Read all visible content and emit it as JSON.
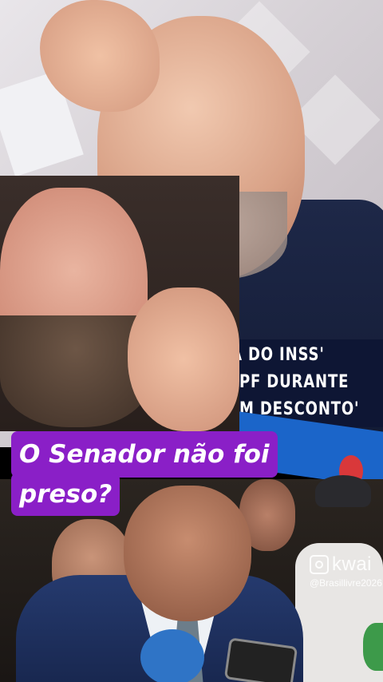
{
  "news_caption": {
    "line1": "ILHO D   ECA DO INSS'",
    "line2": "PF DURANTE",
    "line3": "M DESCONTO'"
  },
  "subtitle": {
    "line1": "O Senador não foi",
    "line2": "preso?"
  },
  "watermark": {
    "brand": "kwai",
    "handle": "@Brasillivre2026"
  },
  "colors": {
    "subtitle_bg": "#8a1fc7",
    "news_band": "#0e1634"
  },
  "icons": {
    "watermark": "kwai-logo-icon"
  }
}
